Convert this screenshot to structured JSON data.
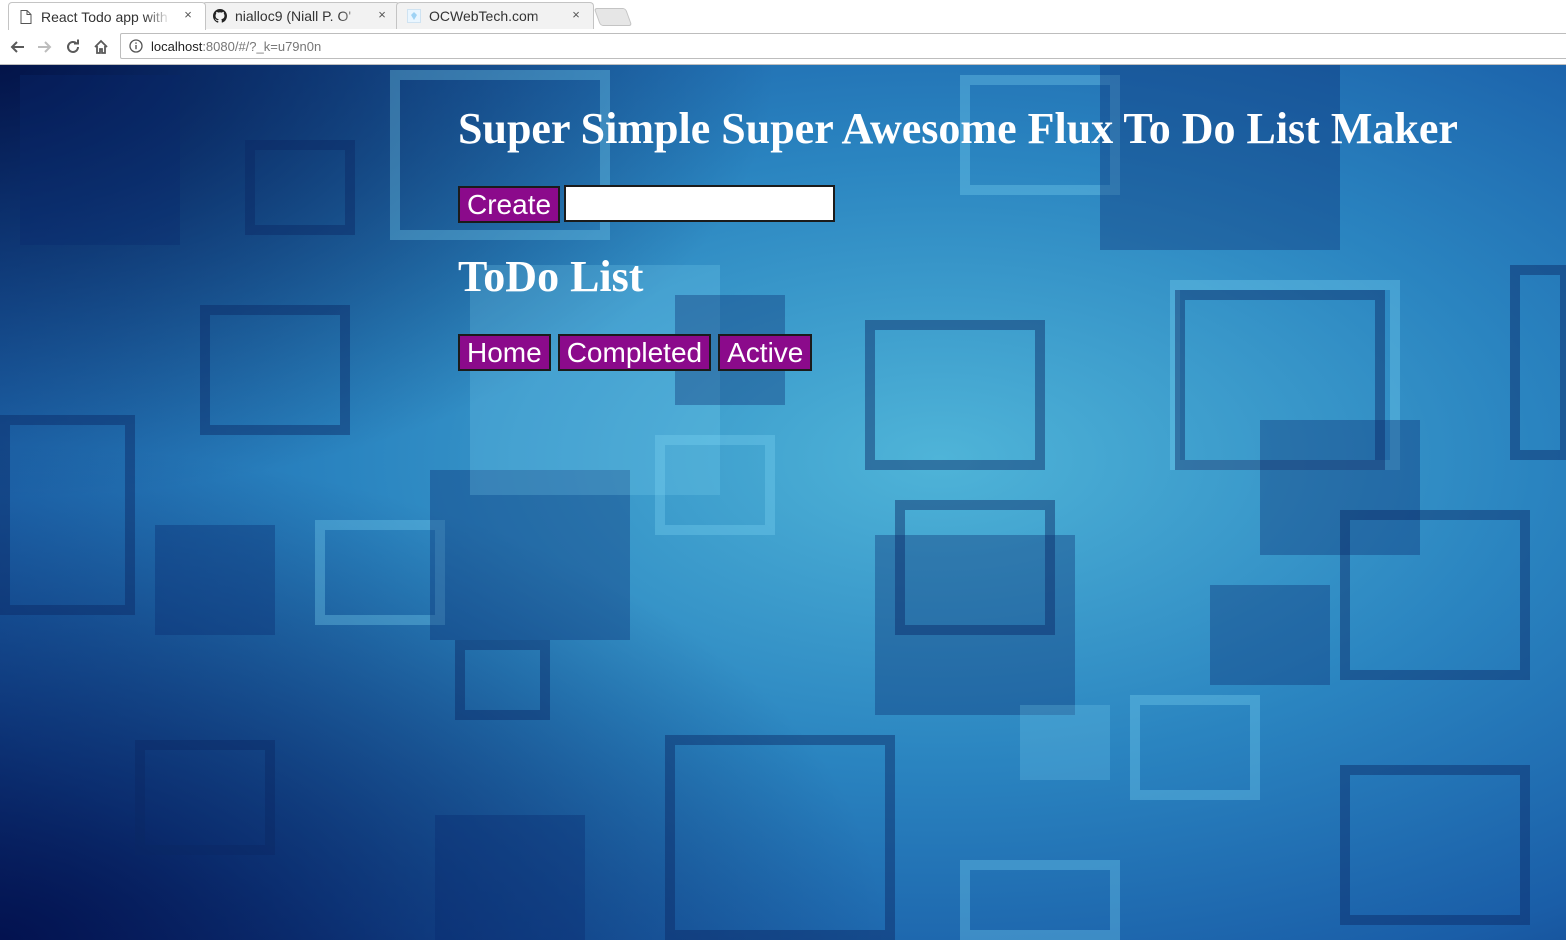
{
  "browser": {
    "tabs": [
      {
        "title": "React Todo app with",
        "icon": "document-icon",
        "active": true
      },
      {
        "title": "nialloc9 (Niall P. O'",
        "icon": "github-icon",
        "active": false
      },
      {
        "title": "OCWebTech.com",
        "icon": "site-icon",
        "active": false
      }
    ],
    "close_glyph": "×",
    "address": {
      "host": "localhost",
      "rest": ":8080/#/?_k=u79n0n"
    }
  },
  "app": {
    "title": "Super Simple Super Awesome Flux To Do List Maker",
    "create_label": "Create",
    "input_value": "",
    "list_title": "ToDo List",
    "filters": {
      "home": "Home",
      "completed": "Completed",
      "active": "Active"
    },
    "colors": {
      "button_bg": "#8b0a8b",
      "text": "#ffffff"
    }
  }
}
